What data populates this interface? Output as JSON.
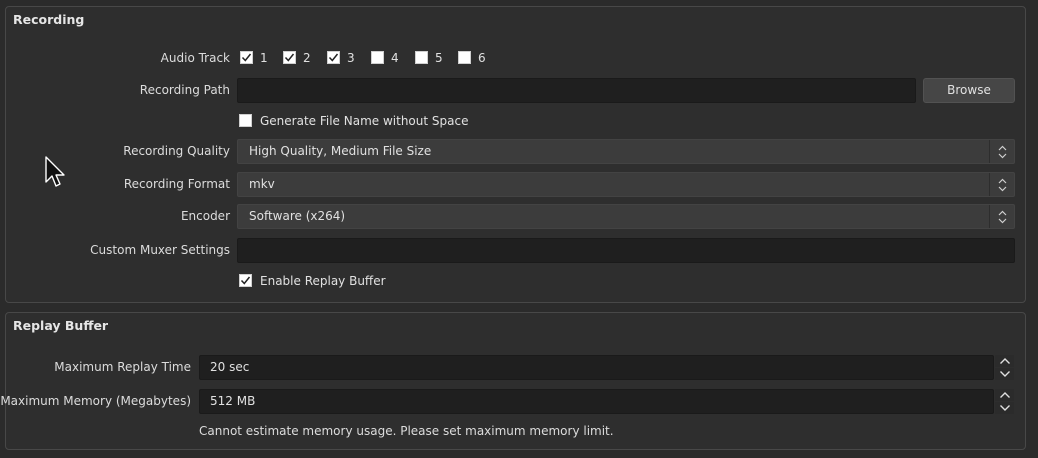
{
  "recording": {
    "title": "Recording",
    "audio_track_label": "Audio Track",
    "tracks": [
      {
        "label": "1",
        "checked": true
      },
      {
        "label": "2",
        "checked": true
      },
      {
        "label": "3",
        "checked": true
      },
      {
        "label": "4",
        "checked": false
      },
      {
        "label": "5",
        "checked": false
      },
      {
        "label": "6",
        "checked": false
      }
    ],
    "path_label": "Recording Path",
    "path_value": "",
    "browse_label": "Browse",
    "filename_nospace_label": "Generate File Name without Space",
    "filename_nospace_checked": false,
    "quality_label": "Recording Quality",
    "quality_value": "High Quality, Medium File Size",
    "format_label": "Recording Format",
    "format_value": "mkv",
    "encoder_label": "Encoder",
    "encoder_value": "Software (x264)",
    "muxer_label": "Custom Muxer Settings",
    "muxer_value": "",
    "replay_enable_label": "Enable Replay Buffer",
    "replay_enable_checked": true
  },
  "replay": {
    "title": "Replay Buffer",
    "max_time_label": "Maximum Replay Time",
    "max_time_value": "20 sec",
    "max_memory_label": "Maximum Memory (Megabytes)",
    "max_memory_value": "512 MB",
    "note": "Cannot estimate memory usage. Please set maximum memory limit."
  },
  "icons": {
    "checkmark": "check-icon",
    "combo_arrows": "updown-chevron-icon",
    "spin_up": "chevron-up-icon",
    "spin_down": "chevron-down-icon",
    "cursor": "mouse-cursor-icon"
  }
}
